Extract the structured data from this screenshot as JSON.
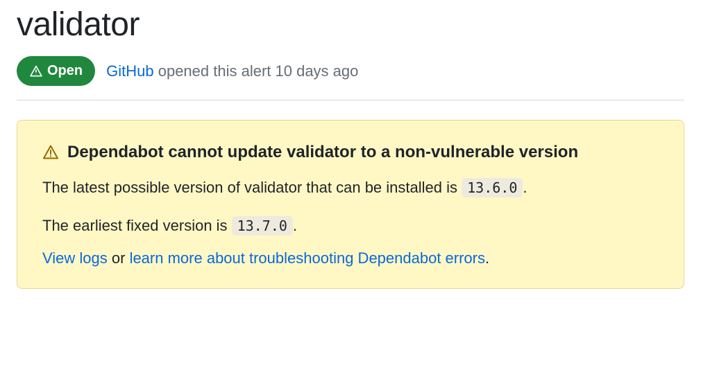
{
  "title": "validator",
  "status": {
    "badge_label": "Open",
    "opener": "GitHub",
    "meta_text": " opened this alert 10 days ago"
  },
  "alert": {
    "heading": "Dependabot cannot update validator to a non-vulnerable version",
    "line1_prefix": "The latest possible version of validator that can be installed is ",
    "line1_version": "13.6.0",
    "line1_suffix": ".",
    "line2_prefix": "The earliest fixed version is ",
    "line2_version": "13.7.0",
    "line2_suffix": ".",
    "view_logs": "View logs",
    "or_text": " or ",
    "learn_more": "learn more about troubleshooting Dependabot errors",
    "trailing": "."
  }
}
